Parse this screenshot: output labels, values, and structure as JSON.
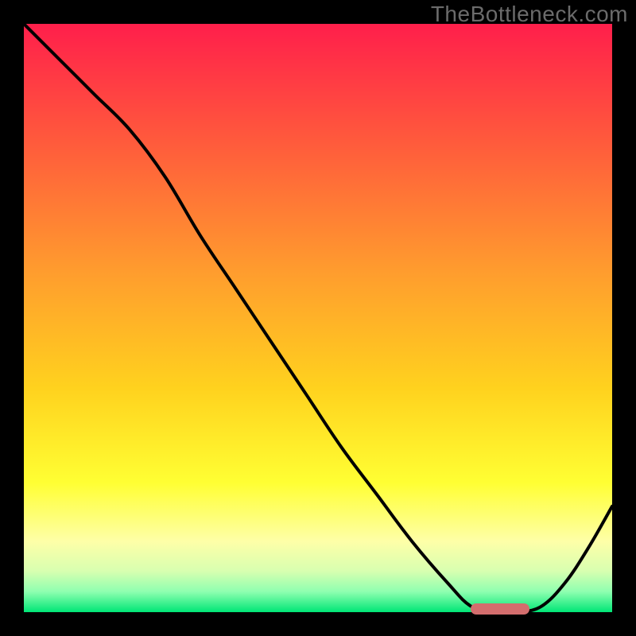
{
  "watermark": "TheBottleneck.com",
  "colors": {
    "black": "#000000",
    "curve": "#000000",
    "marker": "#d36d6d",
    "watermark": "#6b6b6b"
  },
  "chart_data": {
    "type": "line",
    "title": "",
    "xlabel": "",
    "ylabel": "",
    "xlim": [
      0,
      100
    ],
    "ylim": [
      0,
      100
    ],
    "grid": false,
    "legend": false,
    "background_gradient_stops": [
      {
        "pos": 0.0,
        "color": "#ff1f4b"
      },
      {
        "pos": 0.2,
        "color": "#ff5a3c"
      },
      {
        "pos": 0.42,
        "color": "#ff9c2e"
      },
      {
        "pos": 0.62,
        "color": "#ffd21e"
      },
      {
        "pos": 0.78,
        "color": "#ffff33"
      },
      {
        "pos": 0.88,
        "color": "#feffa8"
      },
      {
        "pos": 0.93,
        "color": "#d8ffb0"
      },
      {
        "pos": 0.965,
        "color": "#8fffb0"
      },
      {
        "pos": 1.0,
        "color": "#00e676"
      }
    ],
    "series": [
      {
        "name": "bottleneck-curve",
        "x": [
          0,
          6,
          12,
          18,
          24,
          30,
          36,
          42,
          48,
          54,
          60,
          66,
          72,
          76,
          80,
          84,
          88,
          92,
          96,
          100
        ],
        "y": [
          100,
          94,
          88,
          82,
          74,
          64,
          55,
          46,
          37,
          28,
          20,
          12,
          5,
          1,
          0,
          0,
          1,
          5,
          11,
          18
        ]
      }
    ],
    "optimal_marker": {
      "x_start": 76,
      "x_end": 86,
      "y": 0.5
    }
  }
}
